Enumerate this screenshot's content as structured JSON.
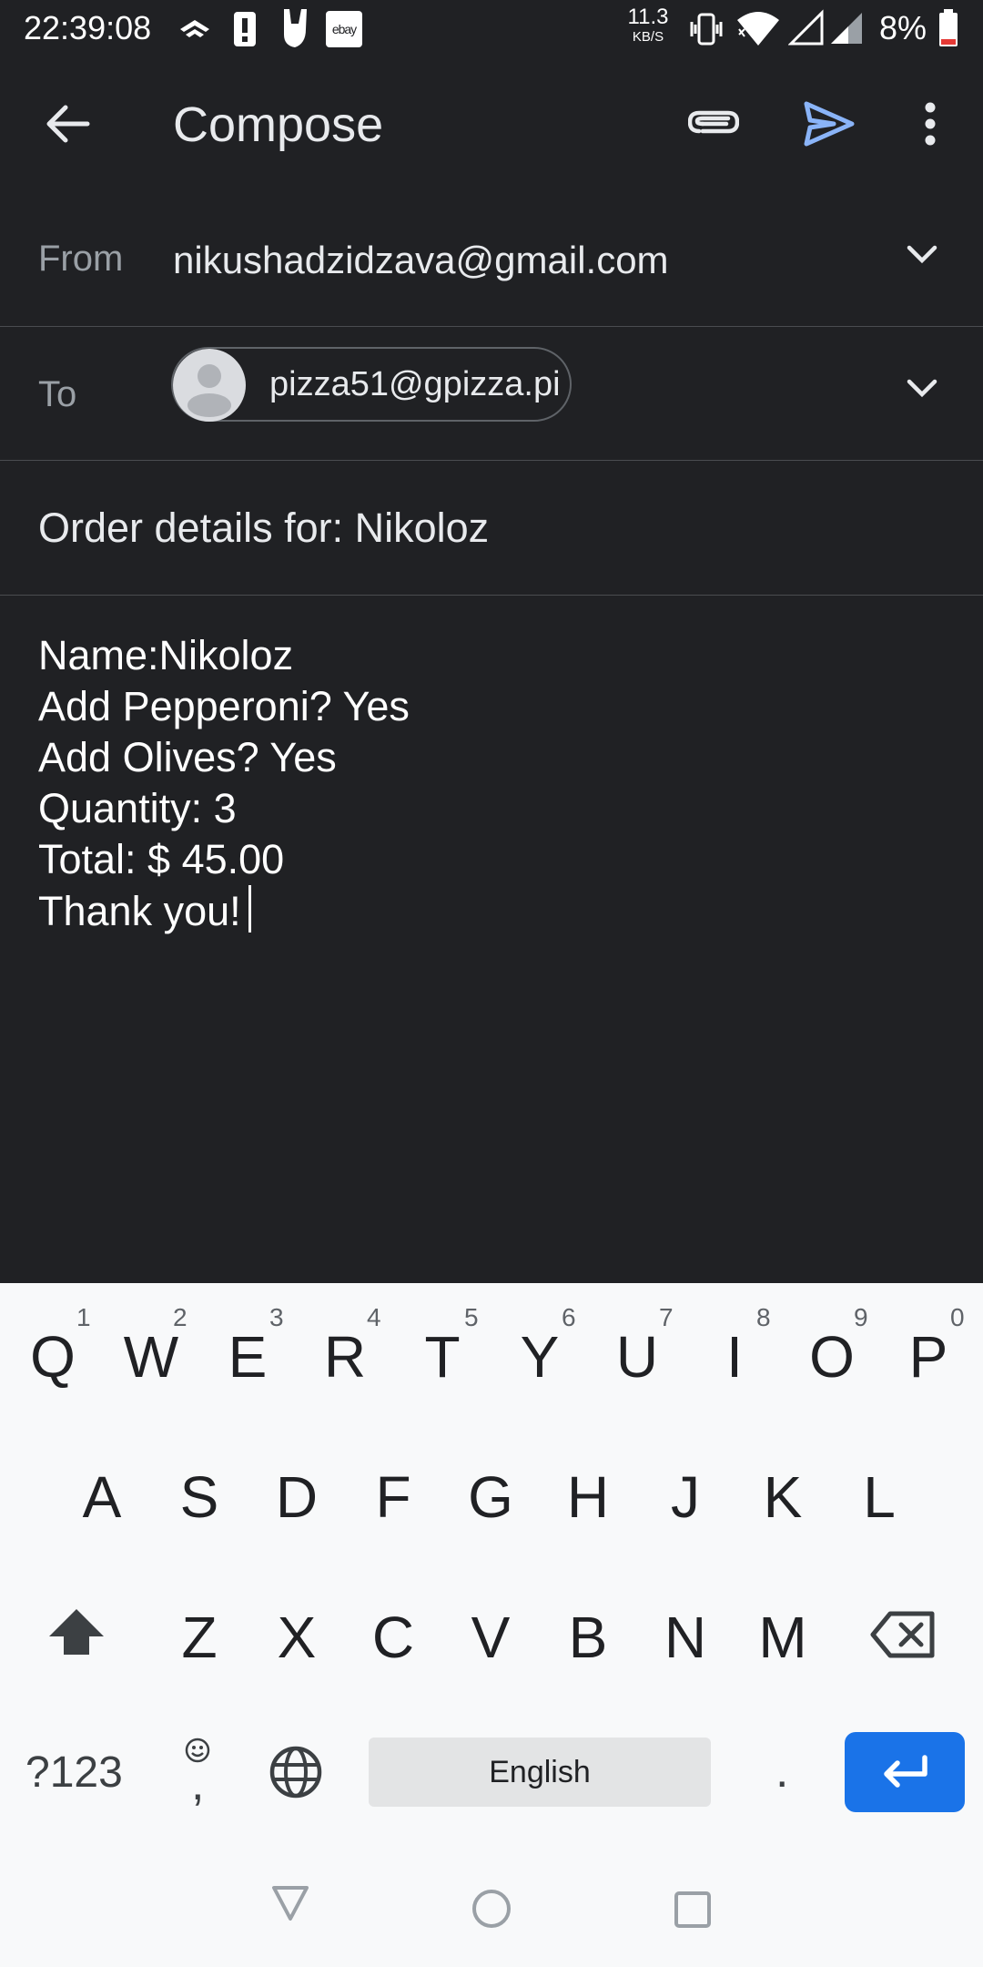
{
  "status_bar": {
    "time": "22:39:08",
    "net_speed_value": "11.3",
    "net_speed_unit": "KB/S",
    "battery_percent": "8%",
    "ebay_label": "ebay",
    "icons": [
      "wifi-direct-icon",
      "alert-icon",
      "rock-hand-icon",
      "ebay-icon",
      "vibrate-icon",
      "wifi-icon",
      "signal-icon",
      "signal-icon-2",
      "battery-icon"
    ]
  },
  "toolbar": {
    "title": "Compose",
    "icons": [
      "back-arrow-icon",
      "attach-icon",
      "send-icon",
      "more-vert-icon"
    ],
    "send_color": "#8ab4f8"
  },
  "from": {
    "label": "From",
    "value": "nikushadzidzava@gmail.com"
  },
  "to": {
    "label": "To",
    "chip": "pizza51@gpizza.pi"
  },
  "subject": {
    "value": "Order details for: Nikoloz"
  },
  "body": {
    "lines": [
      "Name:Nikoloz",
      "Add Pepperoni? Yes",
      "Add Olives? Yes",
      "Quantity: 3",
      "Total: $ 45.00",
      "Thank you!"
    ]
  },
  "keyboard": {
    "row1": [
      "Q",
      "W",
      "E",
      "R",
      "T",
      "Y",
      "U",
      "I",
      "O",
      "P"
    ],
    "row1_hints": [
      "1",
      "2",
      "3",
      "4",
      "5",
      "6",
      "7",
      "8",
      "9",
      "0"
    ],
    "row2": [
      "A",
      "S",
      "D",
      "F",
      "G",
      "H",
      "J",
      "K",
      "L"
    ],
    "row3": [
      "Z",
      "X",
      "C",
      "V",
      "B",
      "N",
      "M"
    ],
    "symbols_label": "?123",
    "comma_label": ",",
    "space_label": "English",
    "period_label": ".",
    "enter_color": "#1a73e8"
  }
}
